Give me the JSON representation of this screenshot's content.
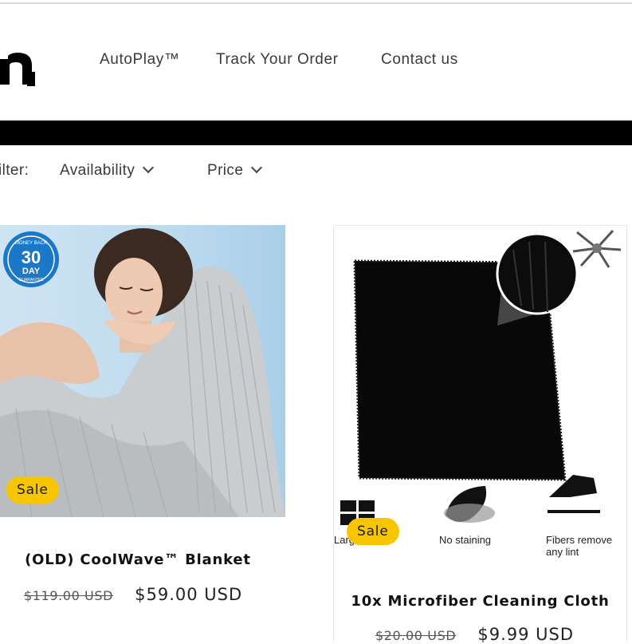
{
  "header": {
    "nav": [
      "AutoPlay™",
      "Track Your Order",
      "Contact us"
    ]
  },
  "filters": {
    "label": "Filter:",
    "availability": "Availability",
    "price": "Price"
  },
  "badge_text": {
    "money_back": "MONEY BACK",
    "days_number": "30",
    "days_word": "DAY",
    "guarantee": "GUARANTEE"
  },
  "products": [
    {
      "badge": "Sale",
      "title": "(OLD) CoolWave™ Blanket",
      "price_old": "$119.00 USD",
      "price_new": "$59.00 USD"
    },
    {
      "badge": "Sale",
      "title": "10x Microfiber Cleaning Cloth",
      "price_old": "$20.00 USD",
      "price_new": "$9.99 USD",
      "features": [
        "Large",
        "No staining",
        "Fibers remove any lint"
      ]
    }
  ],
  "colors": {
    "sale_badge": "#f7c600",
    "black_bar": "#000000",
    "guarantee_badge": "#1b78c6"
  }
}
